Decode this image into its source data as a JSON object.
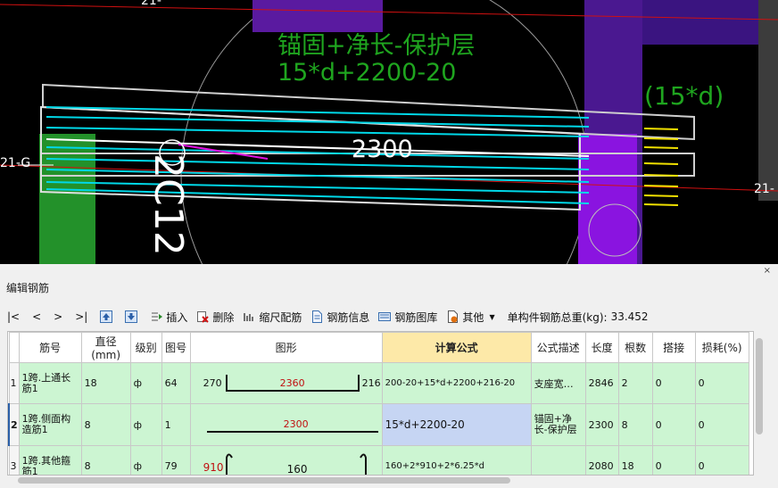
{
  "cad": {
    "axis_labels": [
      "21-",
      "21-G",
      "21-"
    ],
    "formula_line1": "锚固+净长-保护层",
    "formula_line2": "15*d+2200-20",
    "anchor_label": "(15*d)",
    "length_label": "2300",
    "rebar_label": "2C12"
  },
  "panel": {
    "title": "编辑钢筋",
    "close": "×",
    "toolbar": {
      "first": "|<",
      "prev": "<",
      "next": ">",
      "last": ">|",
      "insert": "插入",
      "delete": "删除",
      "scale": "缩尺配筋",
      "info": "钢筋信息",
      "library": "钢筋图库",
      "other": "其他",
      "weight_label": "单构件钢筋总重(kg):",
      "weight_value": "33.452"
    },
    "columns": [
      "筋号",
      "直径(mm)",
      "级别",
      "图号",
      "图形",
      "计算公式",
      "公式描述",
      "长度",
      "根数",
      "搭接",
      "损耗(%)"
    ],
    "rows": [
      {
        "num": "1",
        "name": "1跨.上通长筋1",
        "diameter": "18",
        "grade": "ф",
        "fig": "64",
        "shape_left": "270",
        "shape_mid": "2360",
        "shape_right": "216",
        "formula": "200-20+15*d+2200+216-20",
        "desc": "支座宽…",
        "length": "2846",
        "count": "2",
        "lap": "0",
        "loss": "0"
      },
      {
        "num": "2",
        "name": "1跨.侧面构造筋1",
        "diameter": "8",
        "grade": "ф",
        "fig": "1",
        "shape_mid": "2300",
        "formula": "15*d+2200-20",
        "desc": "锚固+净长-保护层",
        "length": "2300",
        "count": "8",
        "lap": "0",
        "loss": "0"
      },
      {
        "num": "3",
        "name": "1跨.其他箍筋1",
        "diameter": "8",
        "grade": "ф",
        "fig": "79",
        "shape_left": "910",
        "shape_mid": "160",
        "formula": "160+2*910+2*6.25*d",
        "desc": "",
        "length": "2080",
        "count": "18",
        "lap": "0",
        "loss": "0"
      }
    ]
  }
}
